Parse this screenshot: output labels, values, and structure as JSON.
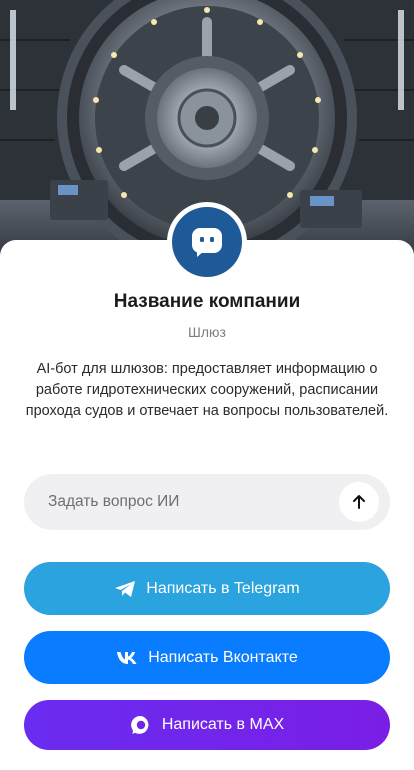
{
  "hero": {
    "image": "vault-gate-illustration",
    "colors": {
      "metal": "#8a929c",
      "light": "#f6e6b0",
      "shadow": "#1a1d22"
    }
  },
  "profile": {
    "avatar_icon": "chat-bot-icon",
    "avatar_color": "#1e5a98",
    "company_name": "Название компании",
    "category": "Шлюз",
    "description": "AI-бот для шлюзов: предоставляет информацию о работе гидротехнических сооружений, расписании прохода судов и отвечает на вопросы пользователей."
  },
  "ask": {
    "placeholder": "Задать вопрос ИИ",
    "value": "",
    "send_icon": "arrow-up-icon"
  },
  "buttons": {
    "telegram": {
      "label": "Написать в Telegram",
      "icon": "telegram-icon",
      "color": "#2aa3de"
    },
    "vk": {
      "label": "Написать Вконтакте",
      "icon": "vk-icon",
      "color": "#0a7cff"
    },
    "max": {
      "label": "Написать в MAX",
      "icon": "max-icon",
      "color": "#6a2cf0"
    }
  }
}
